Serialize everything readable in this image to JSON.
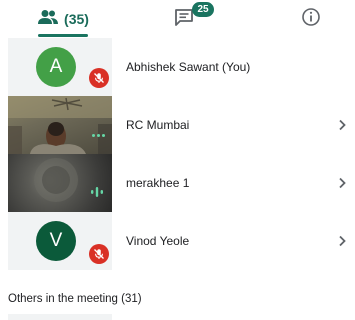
{
  "tabs": {
    "people_count": "(35)",
    "chat_badge": "25"
  },
  "participants": [
    {
      "name": "Abhishek Sawant (You)",
      "initial": "A",
      "avatar_color": "#43a047",
      "muted": true
    },
    {
      "name": "RC Mumbai",
      "video": true
    },
    {
      "name": "merakhee 1",
      "video": true,
      "speaking": true
    },
    {
      "name": "Vinod Yeole",
      "initial": "V",
      "avatar_color": "#0b5a3a",
      "muted": true
    }
  ],
  "others_section": {
    "title": "Others in the meeting (31)"
  },
  "colors": {
    "accent": "#1a7460",
    "mute_red": "#d93025"
  }
}
